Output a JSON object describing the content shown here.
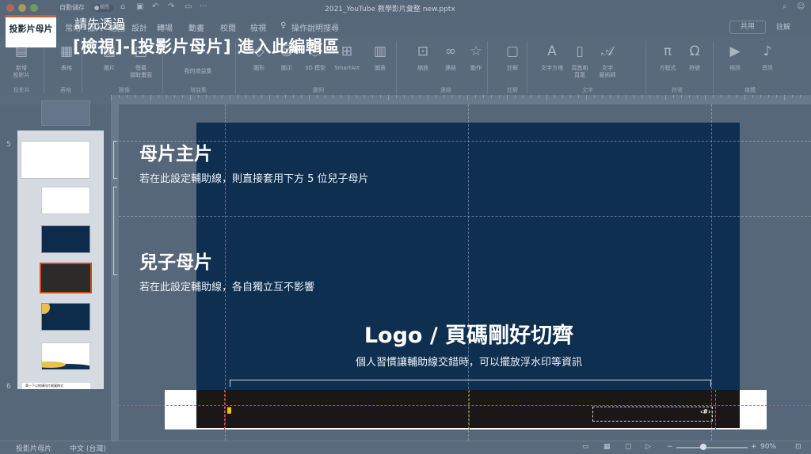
{
  "window": {
    "autosave_label": "自動儲存",
    "autosave_state": "關閉",
    "document_title": "2021_YouTube 教學影片彙整 new.pptx"
  },
  "tabs": [
    "常用",
    "插入",
    "繪圖",
    "設計",
    "轉場",
    "動畫",
    "校閱",
    "檢視"
  ],
  "tell_me": "操作說明搜尋",
  "share_label": "共用",
  "comments_label": "註解",
  "ribbon": {
    "buttons": [
      {
        "icon": "new-layout-icon",
        "label": "新增\n投影片"
      },
      {
        "icon": "table-icon",
        "label": "表格"
      },
      {
        "icon": "picture-icon",
        "label": "圖片"
      },
      {
        "icon": "screenshot-icon",
        "label": "螢幕\n擷取畫面"
      },
      {
        "icon": "addins-icon",
        "label": "我的增益集"
      },
      {
        "icon": "shapes-icon",
        "label": "圖形"
      },
      {
        "icon": "icons-icon",
        "label": "圖示"
      },
      {
        "icon": "3d-model-icon",
        "label": "3D 模型"
      },
      {
        "icon": "smartart-icon",
        "label": "SmartArt"
      },
      {
        "icon": "chart-icon",
        "label": "圖表"
      },
      {
        "icon": "zoom-icon",
        "label": "縮放"
      },
      {
        "icon": "link-icon",
        "label": "連結"
      },
      {
        "icon": "action-icon",
        "label": "動作"
      },
      {
        "icon": "comment-icon",
        "label": "註解"
      },
      {
        "icon": "textbox-icon",
        "label": "文字方塊"
      },
      {
        "icon": "header-footer-icon",
        "label": "頁首和\n頁尾"
      },
      {
        "icon": "wordart-icon",
        "label": "文字\n藝術師"
      },
      {
        "icon": "equation-icon",
        "label": "方程式"
      },
      {
        "icon": "symbol-icon",
        "label": "符號"
      },
      {
        "icon": "video-icon",
        "label": "視訊"
      },
      {
        "icon": "audio-icon",
        "label": "音訊"
      }
    ],
    "groups": [
      "投影片",
      "表格",
      "圖像",
      "增益集",
      "圖例",
      "連結",
      "註解",
      "文字",
      "符號",
      "媒體"
    ]
  },
  "badge_label": "投影片母片",
  "overlay": {
    "hint_line1": "請先透過",
    "hint_line2": "[檢視]-[投影片母片] 進入此編輯區",
    "master_title": "母片主片",
    "master_desc": "若在此設定輔助線，則直接套用下方 5 位兒子母片",
    "child_title": "兒子母片",
    "child_desc": "若在此設定輔助線，各自獨立互不影響",
    "logo_title": "Logo / 頁碼剛好切齊",
    "logo_desc": "個人習慣讓輔助線交錯時，可以擺放浮水印等資訊"
  },
  "workspace": {
    "row_5": "5",
    "row_6": "6",
    "thumb_7_text": "單一下以結構母片截圖樣式",
    "page_number_symbol": "‹#›"
  },
  "status": {
    "view_name": "投影片母片",
    "language": "中文 (台灣)",
    "zoom": "90%"
  },
  "colors": {
    "slide_bg": "#0e2f50",
    "guide_red": "#e0523b",
    "selection_border": "#d14a26",
    "badge_accent": "#cc5a3e"
  }
}
